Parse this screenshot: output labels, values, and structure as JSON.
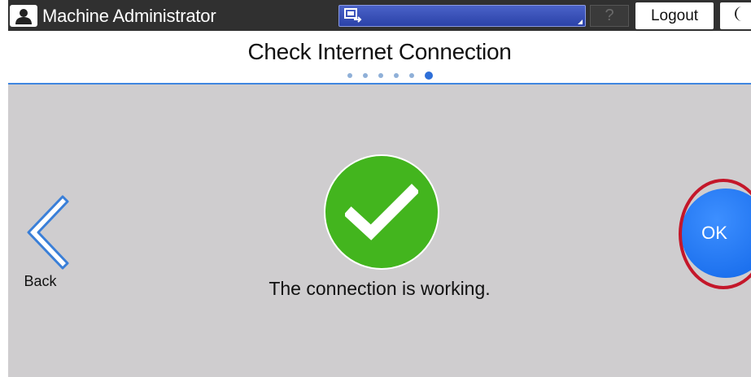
{
  "topbar": {
    "user_name": "Machine Administrator",
    "help_label": "?",
    "logout_label": "Logout"
  },
  "header": {
    "title": "Check Internet Connection",
    "steps_total": 6,
    "current_step": 6
  },
  "main": {
    "back_label": "Back",
    "status_message": "The connection is working.",
    "ok_label": "OK"
  },
  "colors": {
    "topbar_bg": "#303030",
    "accent_blue": "#3f86e0",
    "success_green": "#43b51e",
    "ok_blue": "#1a73f0",
    "highlight_red": "#c4172a",
    "main_bg": "#cfcdcf"
  },
  "icons": {
    "user": "user-icon",
    "job": "job-list-icon",
    "sleep": "moon-icon",
    "back": "chevron-left-icon",
    "success": "checkmark-icon"
  }
}
